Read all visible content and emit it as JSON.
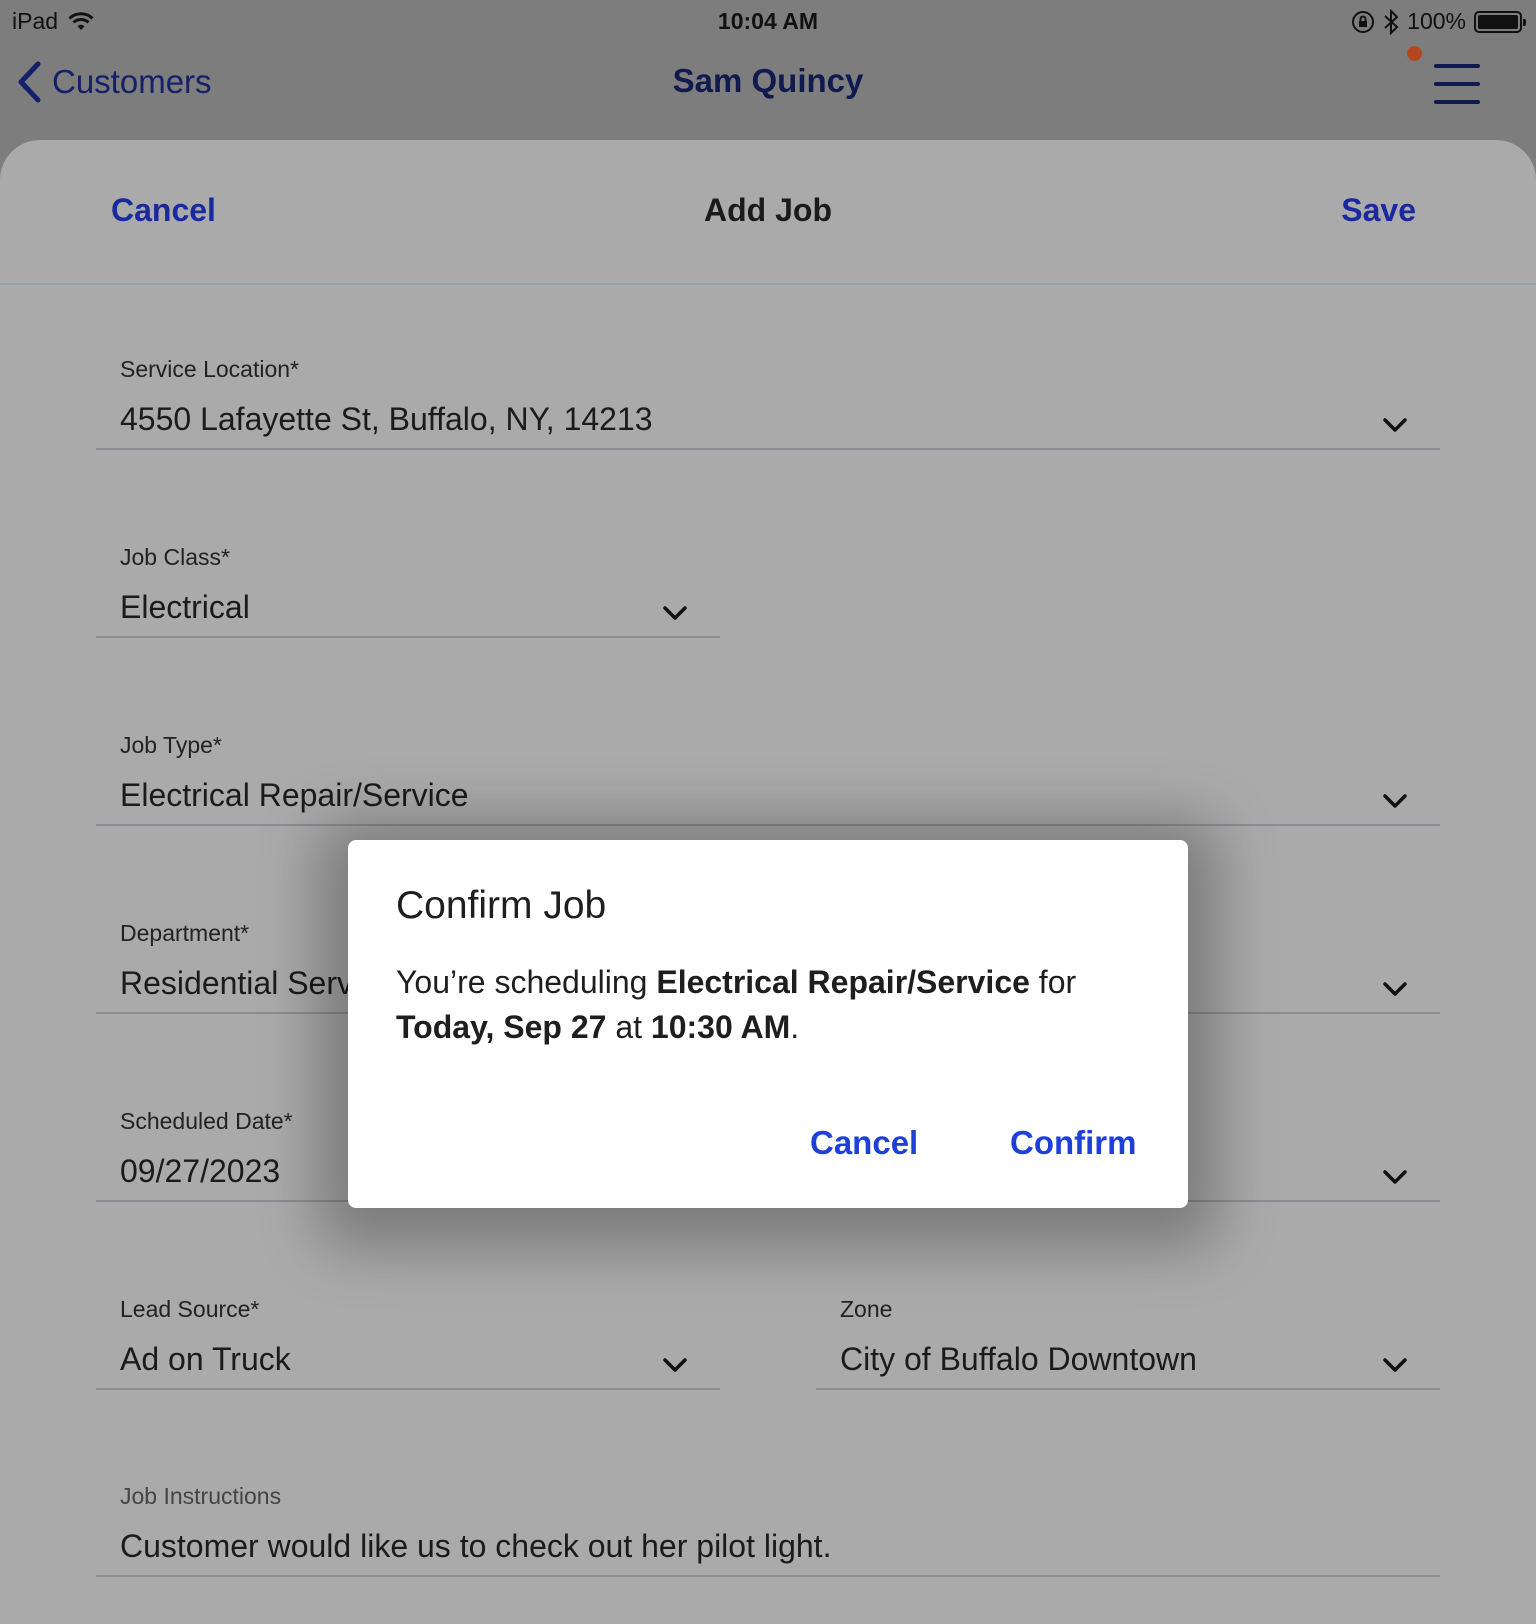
{
  "status_bar": {
    "device": "iPad",
    "time": "10:04 AM",
    "battery": "100%"
  },
  "nav": {
    "back_label": "Customers",
    "title": "Sam Quincy"
  },
  "sheet": {
    "cancel_label": "Cancel",
    "title": "Add Job",
    "save_label": "Save"
  },
  "form": {
    "service_location": {
      "label": "Service Location*",
      "value": "4550 Lafayette St, Buffalo, NY, 14213"
    },
    "job_class": {
      "label": "Job Class*",
      "value": "Electrical"
    },
    "job_type": {
      "label": "Job Type*",
      "value": "Electrical Repair/Service"
    },
    "department": {
      "label": "Department*",
      "value": "Residential Service"
    },
    "scheduled_date": {
      "label": "Scheduled Date*",
      "value": "09/27/2023"
    },
    "lead_source": {
      "label": "Lead Source*",
      "value": "Ad on Truck"
    },
    "zone": {
      "label": "Zone",
      "value": "City of Buffalo Downtown"
    },
    "job_instructions": {
      "label": "Job Instructions",
      "value": "Customer would like us to check out her pilot light."
    }
  },
  "dialog": {
    "title": "Confirm Job",
    "body_prefix": "You’re scheduling ",
    "job_type": "Electrical Repair/Service",
    "body_for": " for",
    "date": "Today, Sep 27",
    "body_at": " at ",
    "time": "10:30 AM",
    "body_suffix": ".",
    "cancel_label": "Cancel",
    "confirm_label": "Confirm"
  },
  "colors": {
    "accent": "#1a2a9e",
    "dialog_button": "#1e3fd9",
    "notification_dot": "#b2481f"
  }
}
